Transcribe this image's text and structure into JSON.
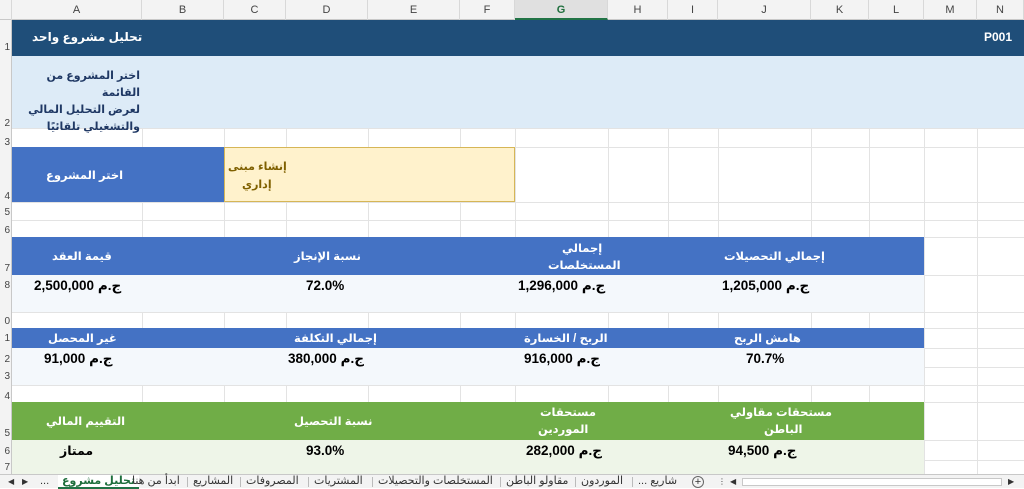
{
  "columns": [
    "A",
    "B",
    "C",
    "D",
    "E",
    "F",
    "G",
    "H",
    "I",
    "J",
    "K",
    "L",
    "M",
    "N"
  ],
  "rows": [
    "1",
    "2",
    "3",
    "4",
    "5",
    "6",
    "7",
    "8",
    "0",
    "1",
    "2",
    "3",
    "4",
    "5",
    "6",
    "7"
  ],
  "title_bar": {
    "title": "تحليل مشروع واحد",
    "code": "P001"
  },
  "instructions": {
    "line1": "اختر المشروع من القائمة",
    "line2": "لعرض التحليل المالي",
    "line3": "والتشغيلي تلقائيًا"
  },
  "selector": {
    "label": "اختر المشروع",
    "value_line1": "إنشاء مبنى",
    "value_line2": "إداري"
  },
  "kpi1": {
    "h1": "قيمة العقد",
    "v1_cur": "ج.م",
    "v1": "2,500,000",
    "h2": "نسبة الإنجاز",
    "v2": "72.0%",
    "h3_l1": "إجمالي",
    "h3_l2": "المستخلصات",
    "v3_cur": "ج.م",
    "v3": "1,296,000",
    "h4": "إجمالي التحصيلات",
    "v4_cur": "ج.م",
    "v4": "1,205,000"
  },
  "kpi2": {
    "h1": "غير المحصل",
    "v1_cur": "ج.م",
    "v1": "91,000",
    "h2": "إجمالي التكلفة",
    "v2_cur": "ج.م",
    "v2": "380,000",
    "h3": "الربح / الخسارة",
    "v3_cur": "ج.م",
    "v3": "916,000",
    "h4": "هامش الربح",
    "v4": "70.7%"
  },
  "kpi3": {
    "h1": "التقييم المالي",
    "v1": "ممتاز",
    "h2": "نسبة التحصيل",
    "v2": "93.0%",
    "h3_l1": "مستحقات",
    "h3_l2": "الموردين",
    "v3_cur": "ج.م",
    "v3": "282,000",
    "h4_l1": "مستحقات مقاولي",
    "h4_l2": "الباطن",
    "v4_cur": "ج.م",
    "v4": "94,500"
  },
  "tabs": {
    "active": "تحليل مشروع",
    "items": [
      "ابدأ من هنا",
      "المشاريع",
      "المصروفات",
      "المشتريات",
      "المستخلصات والتحصيلات",
      "مقاولو الباطن",
      "الموردون",
      "... شاريع"
    ],
    "more": "...",
    "add": "+"
  },
  "colors": {
    "dark_blue": "#1f4e79",
    "blue": "#4472c4",
    "light_blue": "#ddebf7",
    "green": "#70ad47",
    "cream": "#fff2cc",
    "light_green": "#eef5e8"
  }
}
